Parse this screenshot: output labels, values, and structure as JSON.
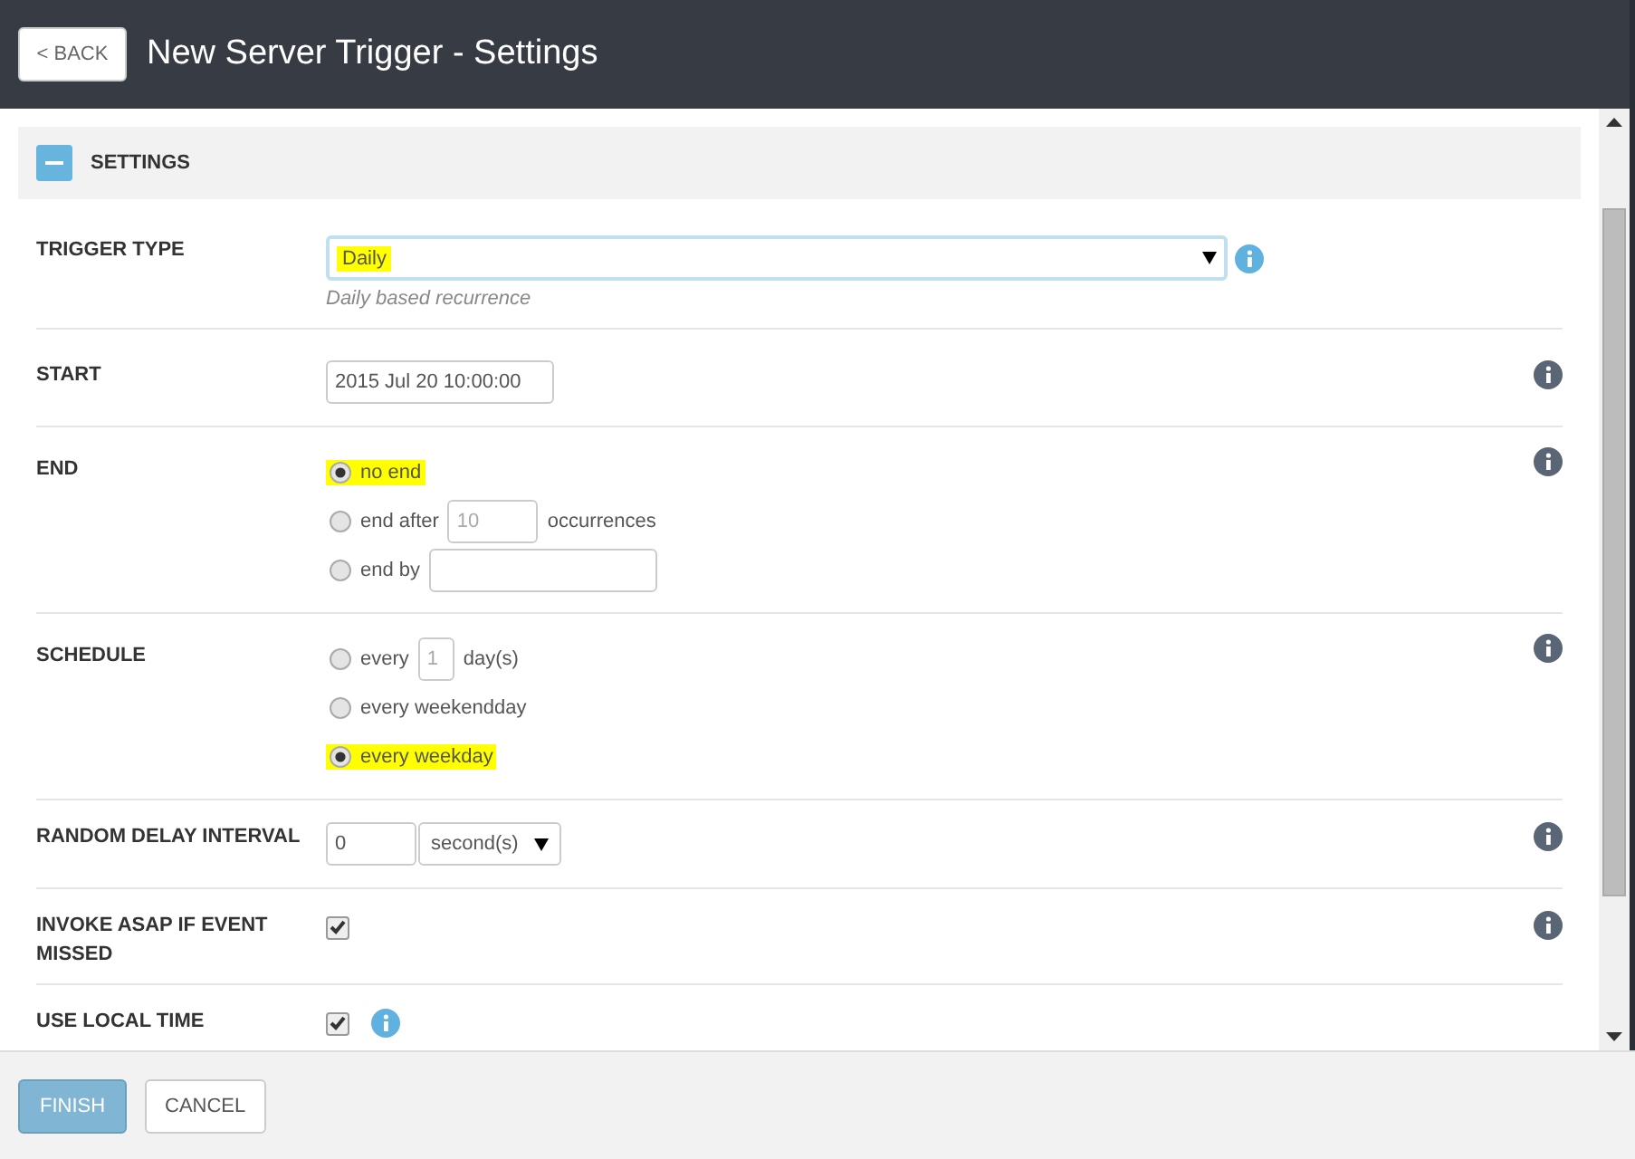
{
  "header": {
    "back_button": "< BACK",
    "title": "New Server Trigger - Settings"
  },
  "section": {
    "title": "SETTINGS",
    "expanded": true
  },
  "rows": [
    {
      "kind": "select",
      "label": "TRIGGER TYPE",
      "value": "Daily",
      "highlighted": true,
      "hint": "Daily based recurrence",
      "info_icon": {
        "kind": "inline"
      }
    },
    {
      "kind": "text",
      "label": "START",
      "value": "2015 Jul 20 10:00:00",
      "info_icon": {
        "kind": "side"
      }
    },
    {
      "kind": "radios",
      "label": "END",
      "info_icon": {
        "kind": "side"
      },
      "options": [
        {
          "selected": true,
          "highlighted": true,
          "parts": [
            {
              "kind": "text",
              "text": "no end"
            }
          ]
        },
        {
          "selected": false,
          "highlighted": false,
          "parts": [
            {
              "kind": "text",
              "text": "end after"
            },
            {
              "kind": "small_field",
              "placeholder": "10"
            },
            {
              "kind": "text",
              "text": "occurrences"
            }
          ]
        },
        {
          "selected": false,
          "highlighted": false,
          "parts": [
            {
              "kind": "text",
              "text": "end by"
            },
            {
              "kind": "wide_field"
            }
          ]
        }
      ]
    },
    {
      "kind": "radios",
      "label": "SCHEDULE",
      "info_icon": {
        "kind": "side"
      },
      "options": [
        {
          "selected": false,
          "highlighted": false,
          "parts": [
            {
              "kind": "text",
              "text": "every"
            },
            {
              "kind": "tiny_field",
              "placeholder": "1"
            },
            {
              "kind": "text",
              "text": "day(s)"
            }
          ]
        },
        {
          "selected": false,
          "highlighted": false,
          "parts": [
            {
              "kind": "text",
              "text": "every weekendday"
            }
          ]
        },
        {
          "selected": true,
          "highlighted": true,
          "parts": [
            {
              "kind": "text",
              "text": "every weekday"
            }
          ]
        }
      ]
    },
    {
      "kind": "number_unit",
      "label": "RANDOM DELAY INTERVAL",
      "value": "0",
      "unit": "second(s)",
      "info_icon": {
        "kind": "side"
      }
    },
    {
      "kind": "checkbox",
      "label": "INVOKE ASAP IF EVENT MISSED",
      "checked": true,
      "info_icon": {
        "kind": "side"
      }
    },
    {
      "kind": "checkbox",
      "label": "USE LOCAL TIME",
      "checked": true,
      "info_icon": {
        "kind": "inline"
      }
    }
  ],
  "footer": {
    "buttons": [
      {
        "label": "FINISH",
        "kind": "primary"
      },
      {
        "label": "CANCEL",
        "kind": "default"
      }
    ]
  }
}
